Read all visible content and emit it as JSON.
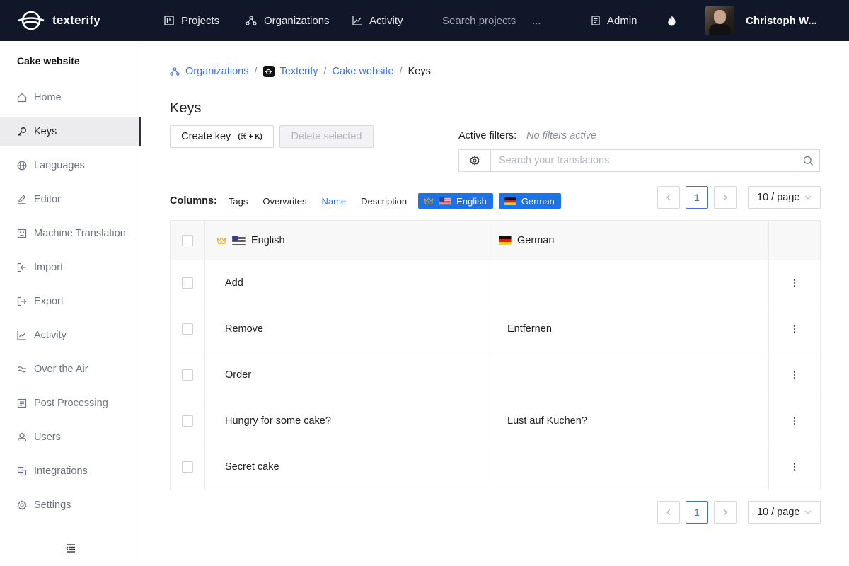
{
  "app": {
    "logo_text": "texterify"
  },
  "topnav": {
    "items": [
      {
        "label": "Projects",
        "icon": "projects-icon"
      },
      {
        "label": "Organizations",
        "icon": "organizations-icon"
      },
      {
        "label": "Activity",
        "icon": "activity-icon"
      }
    ],
    "search_label": "Search projects",
    "ellipsis": "...",
    "admin_label": "Admin",
    "user_name": "Christoph W..."
  },
  "sidebar": {
    "project_name": "Cake website",
    "items": [
      {
        "label": "Home",
        "icon": "home-icon"
      },
      {
        "label": "Keys",
        "icon": "key-icon",
        "active": true
      },
      {
        "label": "Languages",
        "icon": "globe-icon"
      },
      {
        "label": "Editor",
        "icon": "edit-icon"
      },
      {
        "label": "Machine Translation",
        "icon": "robot-icon"
      },
      {
        "label": "Import",
        "icon": "import-icon"
      },
      {
        "label": "Export",
        "icon": "export-icon"
      },
      {
        "label": "Activity",
        "icon": "activity-icon"
      },
      {
        "label": "Over the Air",
        "icon": "over-the-air-icon"
      },
      {
        "label": "Post Processing",
        "icon": "post-processing-icon"
      },
      {
        "label": "Users",
        "icon": "users-icon"
      },
      {
        "label": "Integrations",
        "icon": "integrations-icon"
      },
      {
        "label": "Settings",
        "icon": "settings-icon"
      }
    ]
  },
  "breadcrumb": {
    "organizations": "Organizations",
    "organization": "Texterify",
    "project": "Cake website",
    "current": "Keys",
    "separator": "/"
  },
  "page": {
    "title": "Keys"
  },
  "toolbar": {
    "create_label": "Create key",
    "create_shortcut": "(⌘ + K)",
    "delete_label": "Delete selected"
  },
  "filters": {
    "label": "Active filters:",
    "value": "No filters active",
    "search_placeholder": "Search your translations"
  },
  "columns": {
    "label": "Columns:",
    "toggles": [
      {
        "label": "Tags",
        "active": false
      },
      {
        "label": "Overwrites",
        "active": false
      },
      {
        "label": "Name",
        "active": true
      },
      {
        "label": "Description",
        "active": false
      }
    ],
    "languages": [
      {
        "label": "English",
        "default": true
      },
      {
        "label": "German",
        "default": false
      }
    ]
  },
  "pagination": {
    "current_page": "1",
    "page_size": "10 / page"
  },
  "table": {
    "headers": {
      "english": "English",
      "german": "German"
    },
    "rows": [
      {
        "english": "Add",
        "german": ""
      },
      {
        "english": "Remove",
        "german": "Entfernen"
      },
      {
        "english": "Order",
        "german": ""
      },
      {
        "english": "Hungry for some cake?",
        "german": "Lust auf Kuchen?"
      },
      {
        "english": "Secret cake",
        "german": ""
      }
    ]
  },
  "colors": {
    "topbar_bg": "#0f1729",
    "accent": "#3e6fdc",
    "chip_bg": "#1a73e8",
    "crown": "#e4a918"
  }
}
